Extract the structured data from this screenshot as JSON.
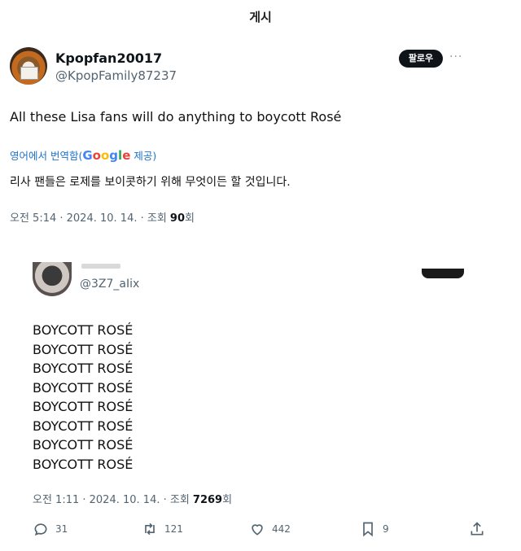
{
  "header": {
    "title": "게시"
  },
  "tweet1": {
    "display_name": "Kpopfan20017",
    "handle": "@KpopFamily87237",
    "follow_label": "팔로우",
    "more": "···",
    "text": "All these Lisa fans will do anything to boycott Rosé",
    "translated_prefix": "영어에서 번역함(",
    "translated_brand": [
      "G",
      "o",
      "o",
      "g",
      "l",
      "e"
    ],
    "translated_suffix": " 제공)",
    "translation": "리사 팬들은 로제를 보이콧하기 위해 무엇이든 할 것입니다.",
    "meta_prefix": "오전 5:14 · 2024. 10. 14. · 조회 ",
    "views": "90",
    "meta_suffix": "회"
  },
  "tweet2": {
    "handle": "@3Z7_aIix",
    "lines": [
      "BOYCOTT ROSÉ",
      "BOYCOTT ROSÉ",
      "BOYCOTT ROSÉ",
      "BOYCOTT ROSÉ",
      "BOYCOTT ROSÉ",
      "BOYCOTT ROSÉ",
      "BOYCOTT ROSÉ",
      "BOYCOTT ROSÉ"
    ],
    "meta_prefix": "오전 1:11 · 2024. 10. 14. · 조회 ",
    "views": "7269",
    "meta_suffix": "회",
    "actions": {
      "reply_count": "31",
      "retweet_count": "121",
      "like_count": "442",
      "bookmark_count": "9"
    }
  },
  "icons": {
    "reply": "reply-icon",
    "retweet": "retweet-icon",
    "like": "heart-icon",
    "bookmark": "bookmark-icon",
    "share": "share-icon"
  }
}
